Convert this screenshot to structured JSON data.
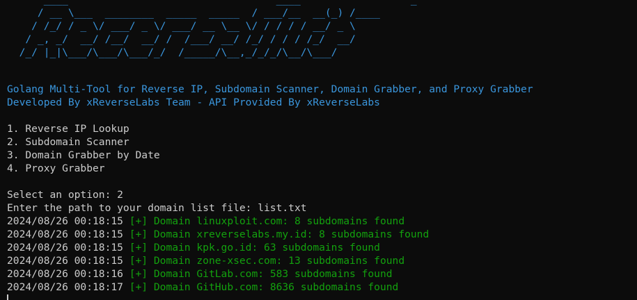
{
  "banner": {
    "art": "      ____                                  ____                  _           \n     / __ \\___  ________  _____  _____  / ___/__  __(_) /____     \n    / /_/ / _ \\/ ___/ _ \\/ ___/ __ \\__ \\/ / / / / __/ _ \\    \n   / _, _/  __/ /__/  __/ /  /___/ __/ /_/ / / / /_/  __/    \n  /_/ |_|\\___/\\___/\\___/_/  /_____/\\__,_/_/_/\\__/\\___/     "
  },
  "header": {
    "line1": "Golang Multi-Tool for Reverse IP, Subdomain Scanner, Domain Grabber, and Proxy Grabber",
    "line2": "Developed By xReverseLabs Team - API Provided By xReverseLabs"
  },
  "menu": {
    "items": [
      "1. Reverse IP Lookup",
      "2. Subdomain Scanner",
      "3. Domain Grabber by Date",
      "4. Proxy Grabber"
    ]
  },
  "prompt": {
    "select": "Select an option: 2",
    "path": "Enter the path to your domain list file: list.txt"
  },
  "logs": [
    {
      "timestamp": "2024/08/26 00:18:15",
      "message": "[+] Domain linuxploit.com: 8 subdomains found"
    },
    {
      "timestamp": "2024/08/26 00:18:15",
      "message": "[+] Domain xreverselabs.my.id: 8 subdomains found"
    },
    {
      "timestamp": "2024/08/26 00:18:15",
      "message": "[+] Domain kpk.go.id: 63 subdomains found"
    },
    {
      "timestamp": "2024/08/26 00:18:15",
      "message": "[+] Domain zone-xsec.com: 13 subdomains found"
    },
    {
      "timestamp": "2024/08/26 00:18:16",
      "message": "[+] Domain GitLab.com: 583 subdomains found"
    },
    {
      "timestamp": "2024/08/26 00:18:17",
      "message": "[+] Domain GitHub.com: 8636 subdomains found"
    }
  ],
  "colors": {
    "background": "#0c0c0c",
    "foreground": "#cccccc",
    "info": "#3a96dd",
    "success": "#13a10e"
  }
}
